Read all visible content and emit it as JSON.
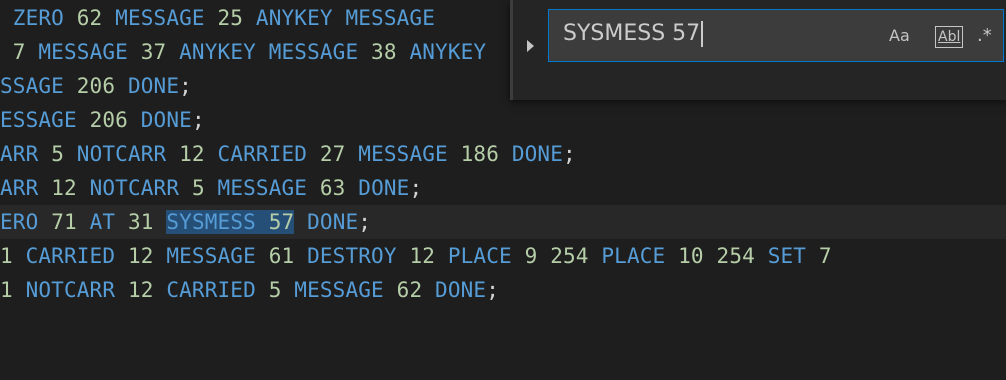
{
  "editor": {
    "lines": [
      {
        "tokens": [
          {
            "t": " ZERO ",
            "c": "kw"
          },
          {
            "t": "62 ",
            "c": "num"
          },
          {
            "t": "MESSAGE ",
            "c": "kw"
          },
          {
            "t": "25 ",
            "c": "num"
          },
          {
            "t": "ANYKEY MESSAGE",
            "c": "kw"
          }
        ]
      },
      {
        "tokens": [
          {
            "t": " 7 ",
            "c": "num"
          },
          {
            "t": "MESSAGE ",
            "c": "kw"
          },
          {
            "t": "37 ",
            "c": "num"
          },
          {
            "t": "ANYKEY MESSAGE ",
            "c": "kw"
          },
          {
            "t": "38 ",
            "c": "num"
          },
          {
            "t": "ANYKEY",
            "c": "kw"
          }
        ]
      },
      {
        "tokens": [
          {
            "t": "SSAGE ",
            "c": "kw"
          },
          {
            "t": "206 ",
            "c": "num"
          },
          {
            "t": "DONE",
            "c": "kw"
          },
          {
            "t": ";",
            "c": "punc"
          }
        ]
      },
      {
        "tokens": [
          {
            "t": "ESSAGE ",
            "c": "kw"
          },
          {
            "t": "206 ",
            "c": "num"
          },
          {
            "t": "DONE",
            "c": "kw"
          },
          {
            "t": ";",
            "c": "punc"
          }
        ]
      },
      {
        "tokens": [
          {
            "t": "ARR ",
            "c": "kw"
          },
          {
            "t": "5 ",
            "c": "num"
          },
          {
            "t": "NOTCARR ",
            "c": "kw"
          },
          {
            "t": "12 ",
            "c": "num"
          },
          {
            "t": "CARRIED ",
            "c": "kw"
          },
          {
            "t": "27 ",
            "c": "num"
          },
          {
            "t": "MESSAGE ",
            "c": "kw"
          },
          {
            "t": "186 ",
            "c": "num"
          },
          {
            "t": "DONE",
            "c": "kw"
          },
          {
            "t": ";",
            "c": "punc"
          }
        ]
      },
      {
        "tokens": [
          {
            "t": "ARR ",
            "c": "kw"
          },
          {
            "t": "12 ",
            "c": "num"
          },
          {
            "t": "NOTCARR ",
            "c": "kw"
          },
          {
            "t": "5 ",
            "c": "num"
          },
          {
            "t": "MESSAGE ",
            "c": "kw"
          },
          {
            "t": "63 ",
            "c": "num"
          },
          {
            "t": "DONE",
            "c": "kw"
          },
          {
            "t": ";",
            "c": "punc"
          }
        ]
      },
      {
        "current": true,
        "tokens": [
          {
            "t": "ERO ",
            "c": "kw"
          },
          {
            "t": "71 ",
            "c": "num"
          },
          {
            "t": "AT ",
            "c": "kw"
          },
          {
            "t": "31 ",
            "c": "num"
          },
          {
            "t": "SYSMESS ",
            "c": "kw",
            "m": true
          },
          {
            "t": "57",
            "c": "num",
            "m": true
          },
          {
            "t": " ",
            "c": "punc"
          },
          {
            "t": "DONE",
            "c": "kw"
          },
          {
            "t": ";",
            "c": "punc"
          }
        ]
      },
      {
        "tokens": [
          {
            "t": "1 ",
            "c": "num"
          },
          {
            "t": "CARRIED ",
            "c": "kw"
          },
          {
            "t": "12 ",
            "c": "num"
          },
          {
            "t": "MESSAGE ",
            "c": "kw"
          },
          {
            "t": "61 ",
            "c": "num"
          },
          {
            "t": "DESTROY ",
            "c": "kw"
          },
          {
            "t": "12 ",
            "c": "num"
          },
          {
            "t": "PLACE ",
            "c": "kw"
          },
          {
            "t": "9 254 ",
            "c": "num"
          },
          {
            "t": "PLACE ",
            "c": "kw"
          },
          {
            "t": "10 254 ",
            "c": "num"
          },
          {
            "t": "SET ",
            "c": "kw"
          },
          {
            "t": "7",
            "c": "num"
          }
        ]
      },
      {
        "tokens": [
          {
            "t": "1 ",
            "c": "num"
          },
          {
            "t": "NOTCARR ",
            "c": "kw"
          },
          {
            "t": "12 ",
            "c": "num"
          },
          {
            "t": "CARRIED ",
            "c": "kw"
          },
          {
            "t": "5 ",
            "c": "num"
          },
          {
            "t": "MESSAGE ",
            "c": "kw"
          },
          {
            "t": "62 ",
            "c": "num"
          },
          {
            "t": "DONE",
            "c": "kw"
          },
          {
            "t": ";",
            "c": "punc"
          }
        ]
      },
      {
        "tokens": []
      }
    ]
  },
  "find": {
    "query": "SYSMESS 57",
    "match_case_label": "Aa",
    "whole_word_label": "Abl",
    "regex_label": ".*"
  },
  "colors": {
    "keyword": "#569cd6",
    "number": "#b5cea8",
    "background": "#1e1e1e",
    "match_highlight": "#264f78"
  }
}
